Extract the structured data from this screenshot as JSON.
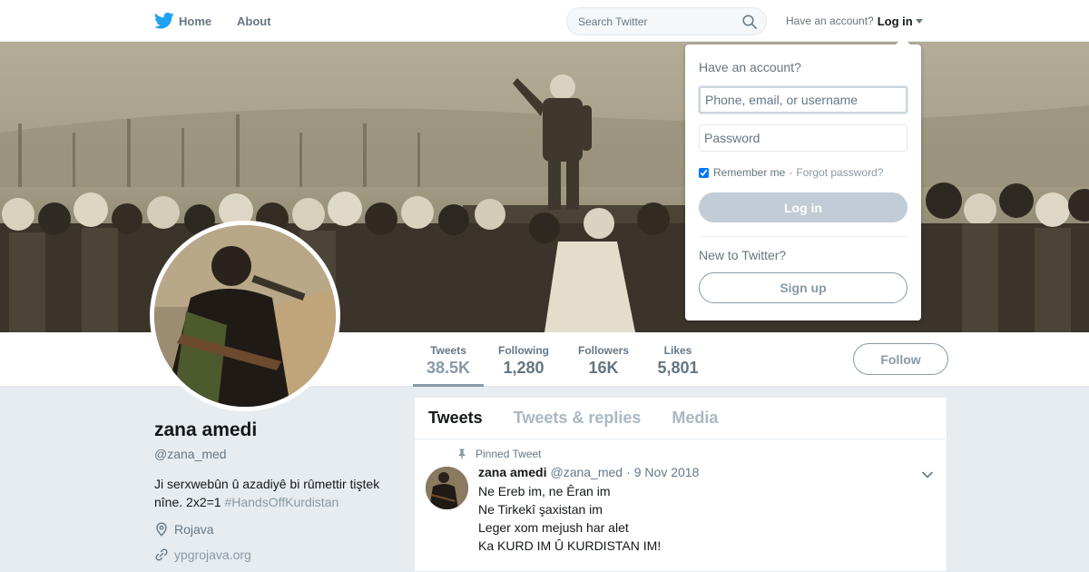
{
  "nav": {
    "home_label": "Home",
    "about_label": "About",
    "search_placeholder": "Search Twitter",
    "have_account": "Have an account?",
    "login_label": "Log in",
    "brand_color": "#1da1f2"
  },
  "profile_nav": {
    "stats": [
      {
        "label": "Tweets",
        "value": "38.5K"
      },
      {
        "label": "Following",
        "value": "1,280"
      },
      {
        "label": "Followers",
        "value": "16K"
      },
      {
        "label": "Likes",
        "value": "5,801"
      }
    ],
    "follow_label": "Follow"
  },
  "profile": {
    "name": "zana amedi",
    "handle": "@zana_med",
    "bio": "Ji serxwebûn û azadiyê bi rûmettir tiştek nîne. 2x2=1 ",
    "bio_hashtag": "#HandsOffKurdistan",
    "location": "Rojava",
    "url": "ypgrojava.org"
  },
  "timeline": {
    "tabs": [
      "Tweets",
      "Tweets & replies",
      "Media"
    ],
    "pinned_label": "Pinned Tweet",
    "tweet": {
      "name": "zana amedi",
      "handle": "@zana_med",
      "separator": "·",
      "date": "9 Nov 2018",
      "lines": [
        "Ne Ereb im, ne Êran im",
        "Ne Tirkekî şaxistan im",
        "Leger xom mejush har alet",
        "Ka KURD IM Û KURDISTAN IM!"
      ]
    }
  },
  "login_dropdown": {
    "heading": "Have an account?",
    "username_placeholder": "Phone, email, or username",
    "password_placeholder": "Password",
    "remember_label": "Remember me",
    "separator": "·",
    "forgot_label": "Forgot password?",
    "login_button": "Log in",
    "new_label": "New to Twitter?",
    "signup_button": "Sign up"
  }
}
